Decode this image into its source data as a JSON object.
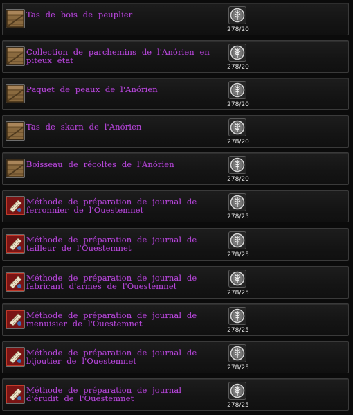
{
  "rows": [
    {
      "name": "Tas de bois de peuplier",
      "count": "278/20",
      "icon": "crate-icon"
    },
    {
      "name": "Collection de parchemins de l'Anórien en piteux état",
      "count": "278/20",
      "icon": "crate-icon"
    },
    {
      "name": "Paquet de peaux de l'Anórien",
      "count": "278/20",
      "icon": "crate-icon"
    },
    {
      "name": "Tas de skarn de l'Anórien",
      "count": "278/20",
      "icon": "crate-icon"
    },
    {
      "name": "Boisseau de récoltes de l'Anórien",
      "count": "278/20",
      "icon": "crate-icon"
    },
    {
      "name": "Méthode de préparation de journal de ferronnier de l'Ouestemnet",
      "count": "278/25",
      "icon": "recipe-scroll-icon"
    },
    {
      "name": "Méthode de préparation de journal de tailleur de l'Ouestemnet",
      "count": "278/25",
      "icon": "recipe-scroll-icon"
    },
    {
      "name": "Méthode de préparation de journal de fabricant d'armes de l'Ouestemnet",
      "count": "278/25",
      "icon": "recipe-scroll-icon"
    },
    {
      "name": "Méthode de préparation de journal de menuisier de l'Ouestemnet",
      "count": "278/25",
      "icon": "recipe-scroll-icon"
    },
    {
      "name": "Méthode de préparation de journal de bijoutier de l'Ouestemnet",
      "count": "278/25",
      "icon": "recipe-scroll-icon"
    },
    {
      "name": "Méthode de préparation de journal d'érudit de l'Ouestemnet",
      "count": "278/25",
      "icon": "recipe-scroll-icon"
    }
  ],
  "cost_icon": "tree-token-icon",
  "colors": {
    "item_name": "#b44ad6",
    "count_text": "#e6e6e6",
    "row_border": "#3a3a3a"
  }
}
